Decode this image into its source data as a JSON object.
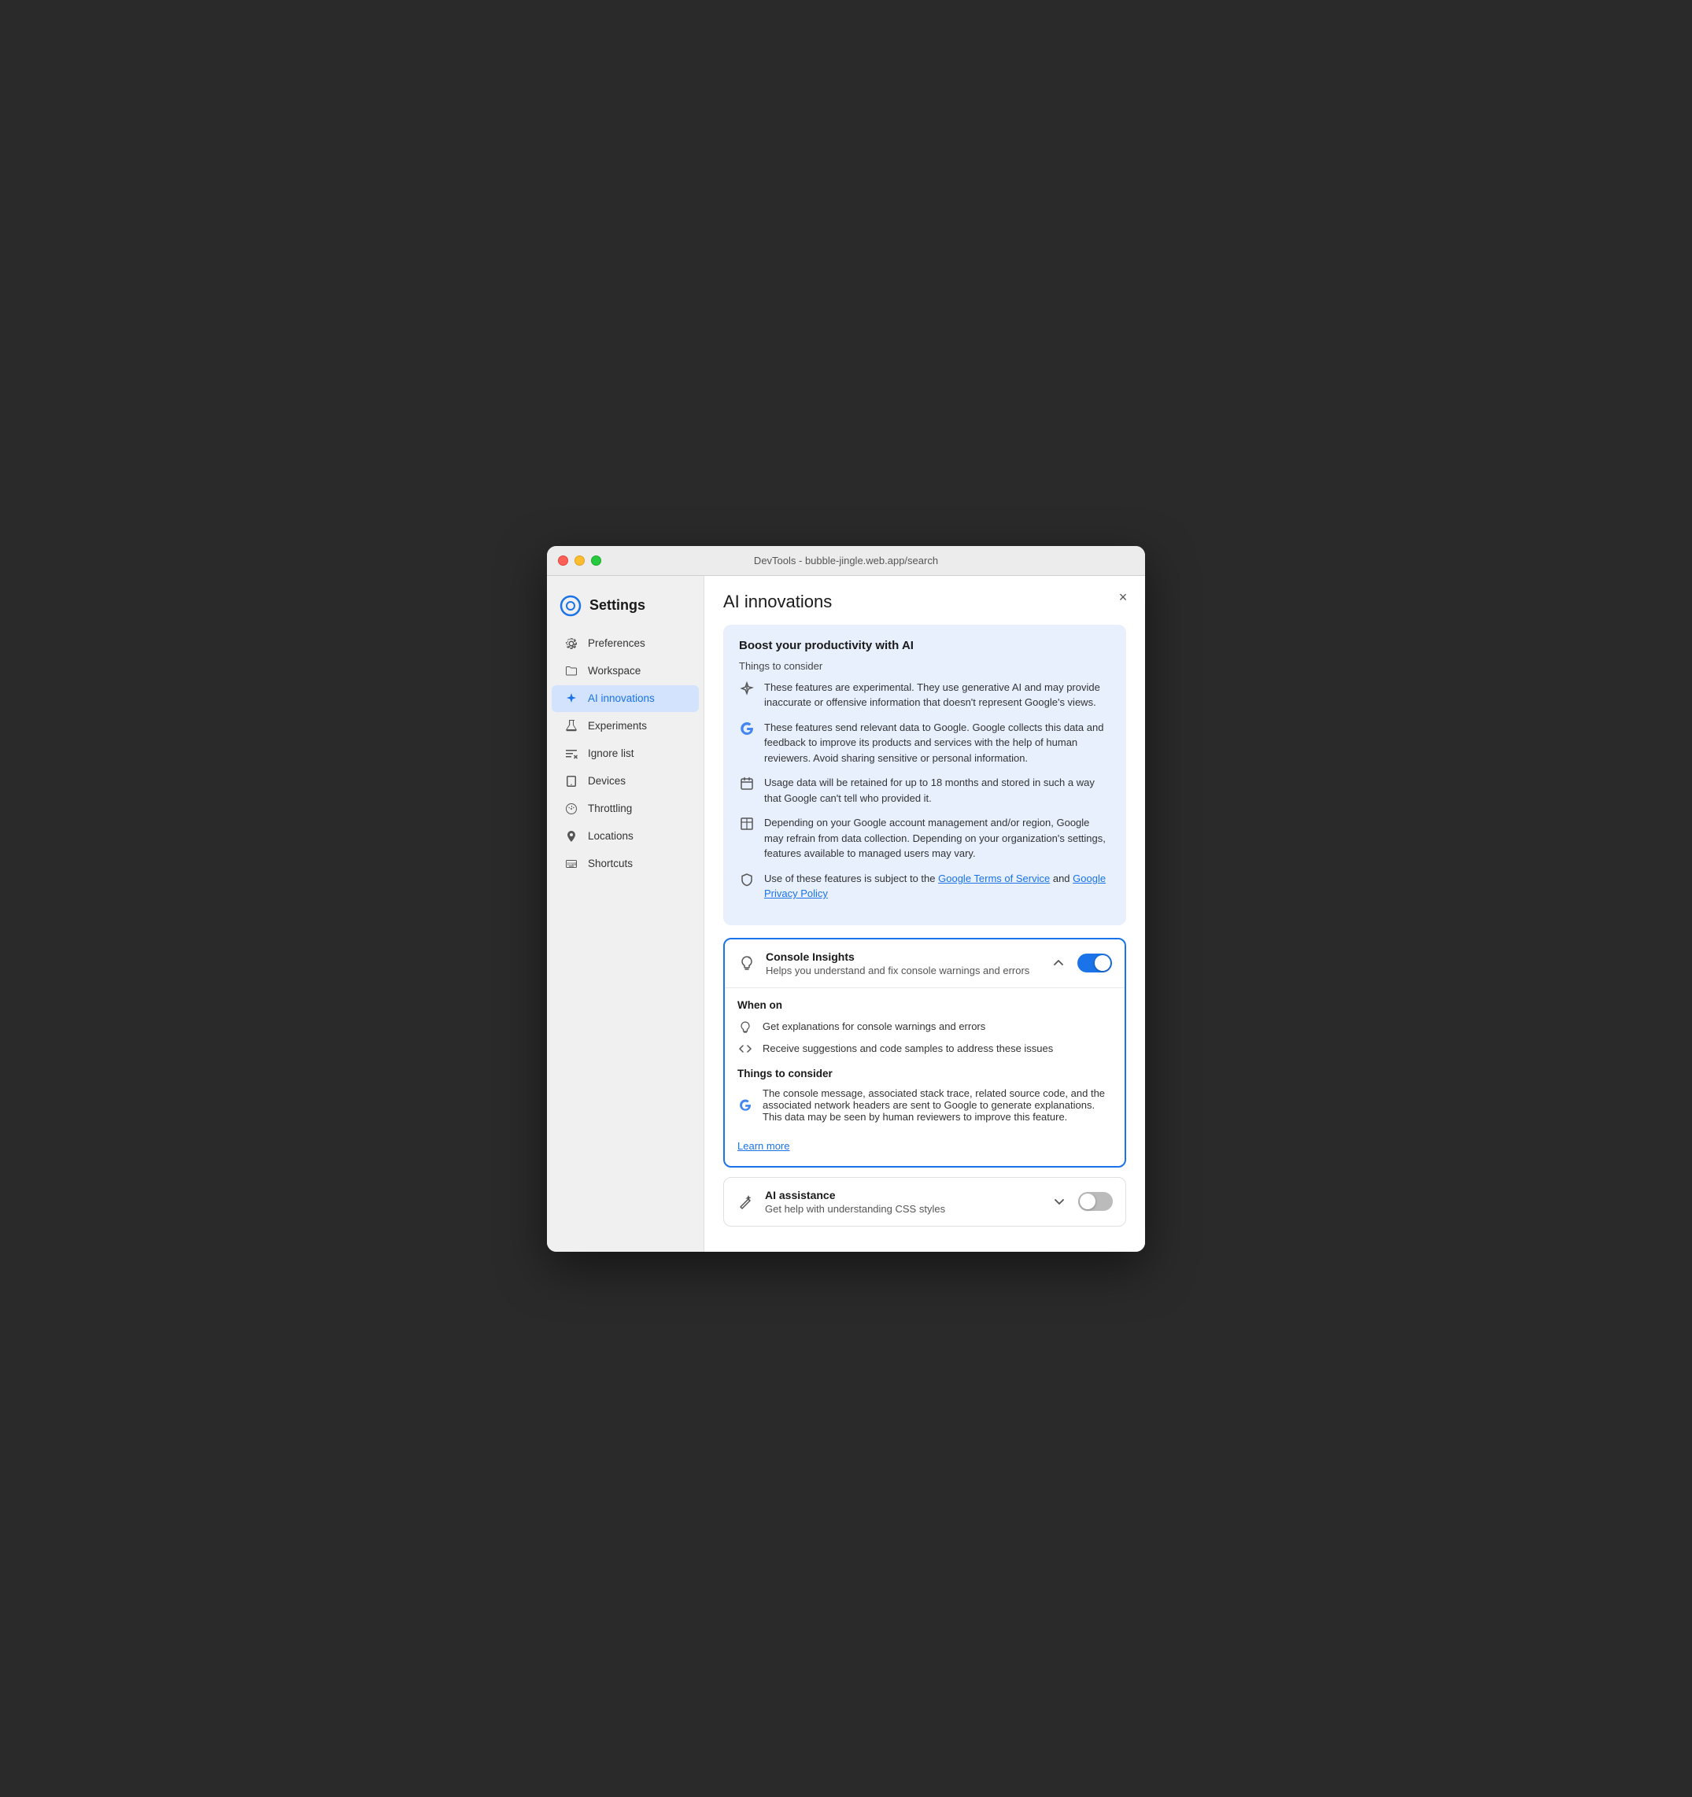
{
  "window": {
    "title": "DevTools - bubble-jingle.web.app/search"
  },
  "sidebar": {
    "title": "Settings",
    "items": [
      {
        "id": "preferences",
        "label": "Preferences",
        "icon": "gear"
      },
      {
        "id": "workspace",
        "label": "Workspace",
        "icon": "folder"
      },
      {
        "id": "ai-innovations",
        "label": "AI innovations",
        "icon": "sparkle",
        "active": true
      },
      {
        "id": "experiments",
        "label": "Experiments",
        "icon": "flask"
      },
      {
        "id": "ignore-list",
        "label": "Ignore list",
        "icon": "list-x"
      },
      {
        "id": "devices",
        "label": "Devices",
        "icon": "device"
      },
      {
        "id": "throttling",
        "label": "Throttling",
        "icon": "gauge"
      },
      {
        "id": "locations",
        "label": "Locations",
        "icon": "pin"
      },
      {
        "id": "shortcuts",
        "label": "Shortcuts",
        "icon": "keyboard"
      }
    ]
  },
  "main": {
    "title": "AI innovations",
    "close_label": "×",
    "info_box": {
      "title": "Boost your productivity with AI",
      "subtitle": "Things to consider",
      "items": [
        {
          "icon": "sparkle-warning",
          "text": "These features are experimental. They use generative AI and may provide inaccurate or offensive information that doesn't represent Google's views."
        },
        {
          "icon": "google-g",
          "text": "These features send relevant data to Google. Google collects this data and feedback to improve its products and services with the help of human reviewers. Avoid sharing sensitive or personal information."
        },
        {
          "icon": "calendar",
          "text": "Usage data will be retained for up to 18 months and stored in such a way that Google can't tell who provided it."
        },
        {
          "icon": "building",
          "text": "Depending on your Google account management and/or region, Google may refrain from data collection. Depending on your organization's settings, features available to managed users may vary."
        },
        {
          "icon": "shield",
          "text_before": "Use of these features is subject to the ",
          "link1_text": "Google Terms of Service",
          "link1_href": "#",
          "text_mid": " and ",
          "link2_text": "Google Privacy Policy",
          "link2_href": "#",
          "text_after": ""
        }
      ]
    },
    "features": [
      {
        "id": "console-insights",
        "icon": "lightbulb-sparkle",
        "name": "Console Insights",
        "desc": "Helps you understand and fix console warnings and errors",
        "expanded": true,
        "enabled": true,
        "when_on_title": "When on",
        "when_on_items": [
          {
            "icon": "lightbulb",
            "text": "Get explanations for console warnings and errors"
          },
          {
            "icon": "code-brackets",
            "text": "Receive suggestions and code samples to address these issues"
          }
        ],
        "things_title": "Things to consider",
        "things_items": [
          {
            "icon": "google-g",
            "text": "The console message, associated stack trace, related source code, and the associated network headers are sent to Google to generate explanations. This data may be seen by human reviewers to improve this feature."
          }
        ],
        "learn_more_label": "Learn more",
        "learn_more_href": "#"
      },
      {
        "id": "ai-assistance",
        "icon": "sparkle-wand",
        "name": "AI assistance",
        "desc": "Get help with understanding CSS styles",
        "expanded": false,
        "enabled": false
      }
    ]
  }
}
